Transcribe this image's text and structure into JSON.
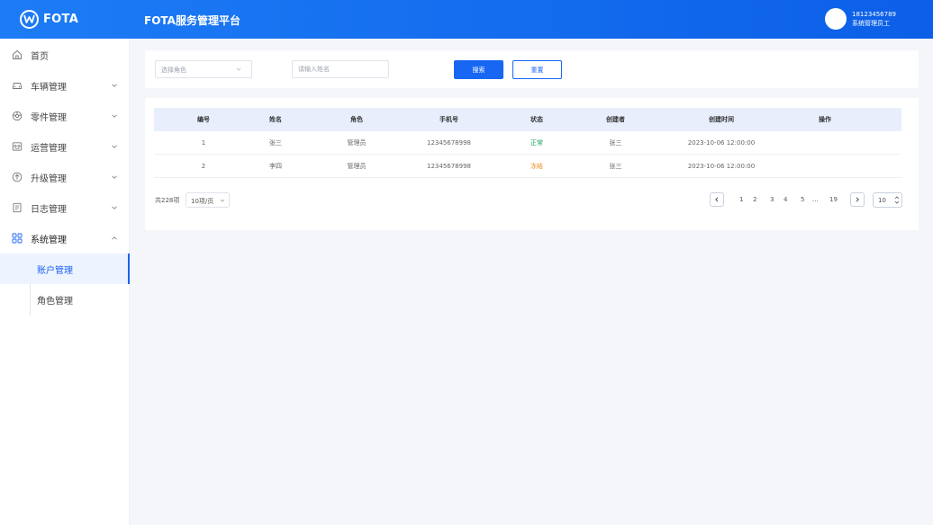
{
  "header": {
    "logo_text": "FOTA",
    "app_title": "FOTA服务管理平台",
    "user_phone": "18123456789",
    "user_role": "系统管理员工"
  },
  "sidebar": {
    "items": [
      {
        "label": "首页",
        "icon": "home-icon"
      },
      {
        "label": "车辆管理",
        "icon": "car-icon"
      },
      {
        "label": "零件管理",
        "icon": "part-icon"
      },
      {
        "label": "运营管理",
        "icon": "operation-icon"
      },
      {
        "label": "升级管理",
        "icon": "upgrade-icon"
      },
      {
        "label": "日志管理",
        "icon": "log-icon"
      },
      {
        "label": "系统管理",
        "icon": "grid-icon"
      }
    ],
    "sub_items": [
      {
        "label": "账户管理",
        "active": true
      },
      {
        "label": "角色管理",
        "active": false
      }
    ]
  },
  "filter": {
    "role_placeholder": "选择角色",
    "name_placeholder": "请输入姓名",
    "search_label": "搜索",
    "reset_label": "重置"
  },
  "table": {
    "columns": [
      "编号",
      "姓名",
      "角色",
      "手机号",
      "状态",
      "创建者",
      "创建时间",
      "操作"
    ],
    "rows": [
      {
        "id": "1",
        "name": "张三",
        "role": "管理员",
        "phone": "12345678998",
        "status": "正常",
        "creator": "张三",
        "created": "2023-10-06 12:00:00"
      },
      {
        "id": "2",
        "name": "李四",
        "role": "管理员",
        "phone": "12345678998",
        "status": "冻结",
        "creator": "张三",
        "created": "2023-10-06 12:00:00"
      }
    ]
  },
  "pagination": {
    "total": "共228项",
    "page_size": "10项/页",
    "pages": [
      "1",
      "2",
      "3",
      "4",
      "5",
      "...",
      "19"
    ],
    "jump_value": "10"
  },
  "colors": {
    "primary": "#1767f2",
    "status_normal": "#1a9c5a",
    "status_frozen": "#f08a1c"
  }
}
